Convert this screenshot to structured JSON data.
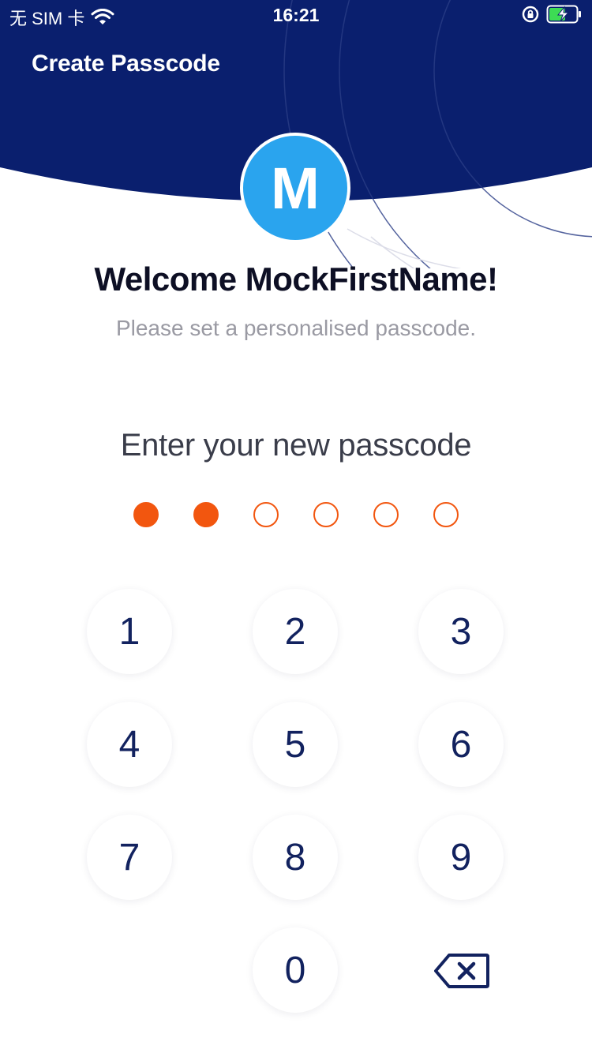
{
  "status_bar": {
    "carrier": "无 SIM 卡",
    "time": "16:21"
  },
  "header": {
    "title": "Create Passcode",
    "background_color": "#0a1f6e"
  },
  "avatar": {
    "initial": "M",
    "color": "#2aa4ee"
  },
  "welcome": {
    "heading": "Welcome MockFirstName!",
    "subtitle": "Please set a personalised passcode."
  },
  "passcode": {
    "prompt": "Enter your new passcode",
    "length": 6,
    "filled": 2,
    "accent_color": "#f2560f"
  },
  "keypad": {
    "keys": [
      "1",
      "2",
      "3",
      "4",
      "5",
      "6",
      "7",
      "8",
      "9",
      "0"
    ],
    "delete_icon": "backspace-icon"
  }
}
